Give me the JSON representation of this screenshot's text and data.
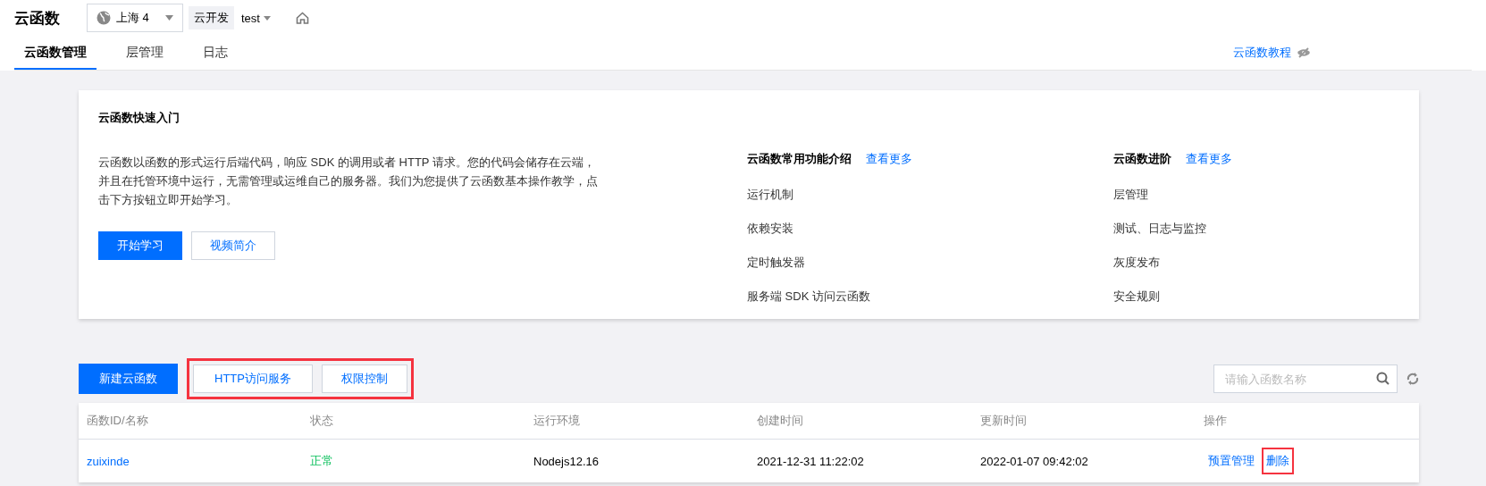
{
  "header": {
    "title": "云函数",
    "region": "上海 4",
    "env_tag": "云开发",
    "env": "test"
  },
  "tabs": [
    {
      "label": "云函数管理",
      "selected": true
    },
    {
      "label": "层管理",
      "selected": false
    },
    {
      "label": "日志",
      "selected": false
    }
  ],
  "tutorial_link": "云函数教程",
  "quickstart": {
    "title": "云函数快速入门",
    "description": "云函数以函数的形式运行后端代码，响应 SDK 的调用或者 HTTP 请求。您的代码会储存在云端，并且在托管环境中运行，无需管理或运维自己的服务器。我们为您提供了云函数基本操作教学，点击下方按钮立即开始学习。",
    "buttons": [
      {
        "label": "开始学习",
        "kind": "primary"
      },
      {
        "label": "视频简介",
        "kind": "secondary"
      }
    ],
    "sections": [
      {
        "title": "云函数常用功能介绍",
        "more": "查看更多",
        "items": [
          "运行机制",
          "依赖安装",
          "定时触发器",
          "服务端 SDK 访问云函数"
        ]
      },
      {
        "title": "云函数进阶",
        "more": "查看更多",
        "items": [
          "层管理",
          "测试、日志与监控",
          "灰度发布",
          "安全规则"
        ]
      }
    ]
  },
  "toolbar": {
    "create_button": "新建云函数",
    "buttons": [
      "HTTP访问服务",
      "权限控制"
    ],
    "buttons_highlighted": true,
    "search": {
      "placeholder": "请输入函数名称"
    }
  },
  "table": {
    "columns": [
      "函数ID/名称",
      "状态",
      "运行环境",
      "创建时间",
      "更新时间",
      "操作"
    ],
    "rows": [
      {
        "name": "zuixinde",
        "status": "正常",
        "runtime": "Nodejs12.16",
        "created": "2021-12-31 11:22:02",
        "updated": "2022-01-07 09:42:02",
        "actions": [
          {
            "label": "预置管理",
            "highlighted": false
          },
          {
            "label": "删除",
            "highlighted": true
          }
        ]
      }
    ]
  }
}
